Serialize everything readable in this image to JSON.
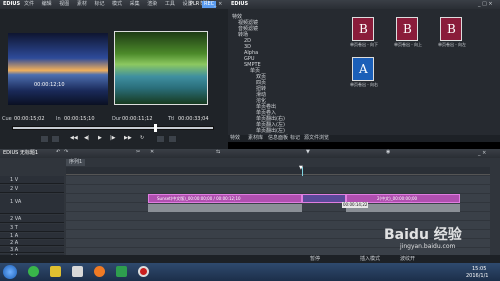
{
  "app": {
    "title": "EDIUS",
    "menu": [
      "文件",
      "编辑",
      "视图",
      "素材",
      "标记",
      "模式",
      "采集",
      "渲染",
      "工具",
      "设置",
      "帮助"
    ],
    "mode_badge": "PLR",
    "rec_badge": "REC"
  },
  "preview": {
    "timecode_left": "00:00:12;10",
    "cue_label": "Cue",
    "cue_value": "00:00:15;02",
    "in_label": "In",
    "in_value": "00:00:15;10",
    "dur_label": "Dur",
    "dur_value": "00:00:11;12",
    "ttl_label": "Ttl",
    "ttl_value": "00:00:33;04"
  },
  "effects_panel": {
    "title": "EDIUS",
    "tree": [
      "特效",
      "视频滤镜",
      "音频滤镜",
      "转场",
      "2D",
      "3D",
      "Alpha",
      "GPU",
      "SMPTE",
      "单页",
      "双页",
      "四页",
      "扭转",
      "滑动",
      "溶化",
      "单页卷出",
      "单页卷入",
      "单页翻出(右)",
      "单页翻入(左)",
      "单页翻出(左)",
      "单页翻入(左右)"
    ],
    "thumbs": [
      {
        "letter": "B",
        "label": "单页卷出 - 向下"
      },
      {
        "letter": "B",
        "label": "单页卷出 - 向上"
      },
      {
        "letter": "B",
        "label": "单页卷出 - 向左"
      },
      {
        "letter": "A",
        "label": "单页卷出 - 向右"
      }
    ],
    "tabs": [
      "特效",
      "素材库",
      "信息面板",
      "标记",
      "源文件浏览"
    ]
  },
  "timeline": {
    "project_label": "EDIUS 无标题1",
    "sequence_tab": "序列1",
    "tracks": [
      "1 V",
      "2 V",
      "1 VA",
      "2 VA",
      "3 T",
      "1 A",
      "2 A",
      "3 A",
      "4 A"
    ],
    "clip_left_text": "Sunset(中文版)_00:00:00;00 / 00:00:12;10",
    "clip_right_text": "2(中文)_00:00:00;00",
    "tooltip": "00:00:14;22"
  },
  "statusbar": {
    "left": "暂停",
    "right_1": "插入模式",
    "right_2": "波纹开"
  },
  "taskbar": {
    "time": "15:05",
    "date": "2016/1/1"
  },
  "watermark": {
    "brand": "Baidu 经验",
    "url": "jingyan.baidu.com"
  },
  "colors": {
    "accent": "#5b9cf0",
    "clip": "#b04fb0",
    "thumb_red": "#8a1c3a",
    "thumb_blue": "#1b5fb8",
    "panel_bg": "#262a30"
  }
}
